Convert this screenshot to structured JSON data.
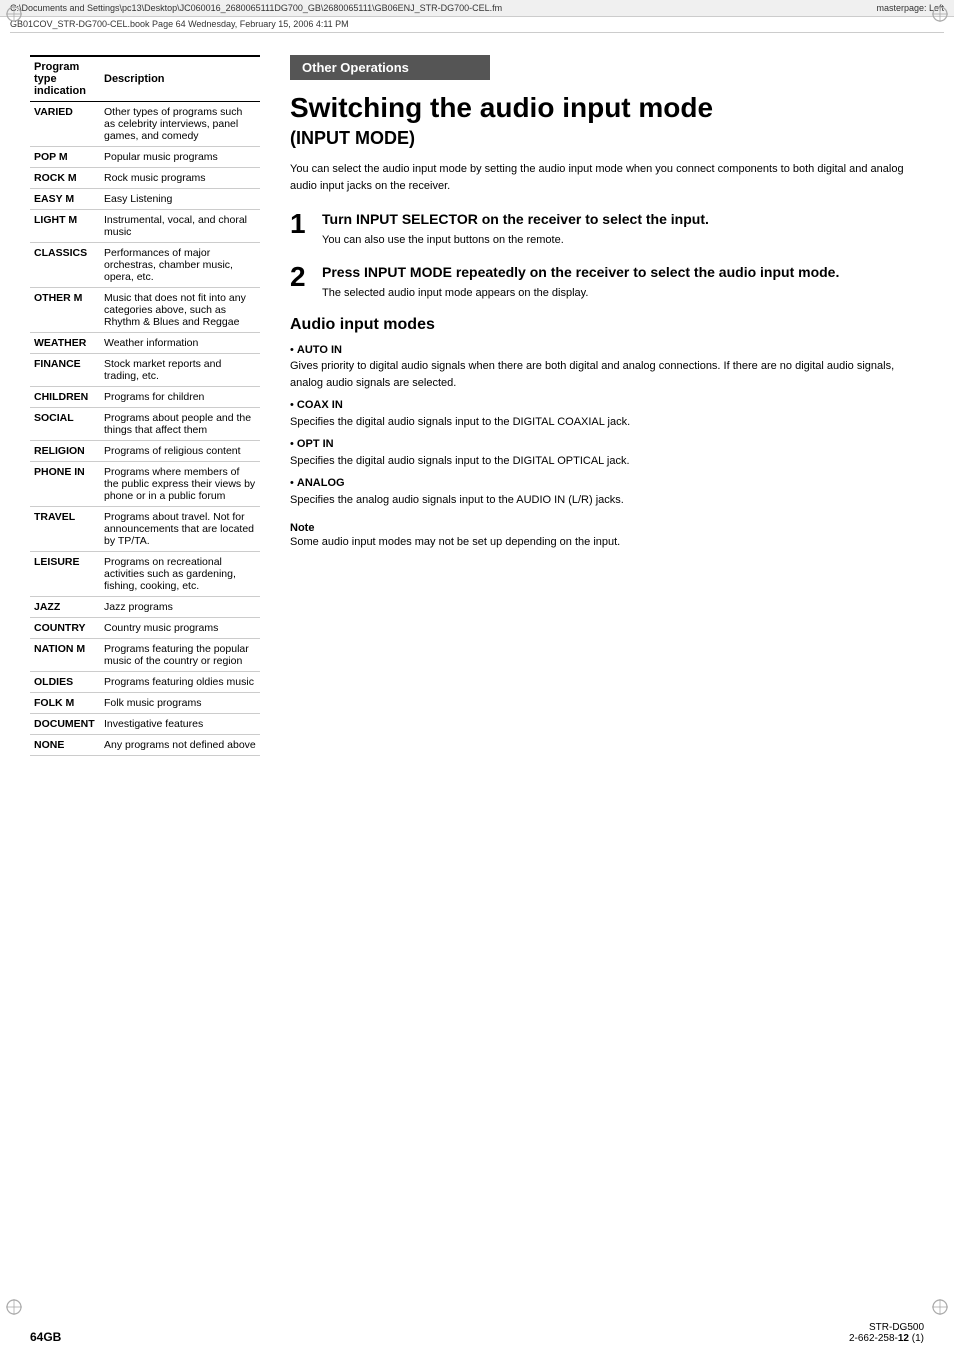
{
  "header": {
    "left_path": "C:\\Documents and Settings\\pc13\\Desktop\\JC060016_2680065111DG700_GB\\2680065111\\GB06ENJ_STR-DG700-CEL.fm",
    "right_label": "masterpage: Left",
    "book_info": "GB01COV_STR-DG700-CEL.book  Page 64  Wednesday, February 15, 2006  4:11 PM"
  },
  "table": {
    "col1_header": "Program type indication",
    "col2_header": "Description",
    "rows": [
      {
        "type": "VARIED",
        "desc": "Other types of programs such as celebrity interviews, panel games, and comedy"
      },
      {
        "type": "POP M",
        "desc": "Popular music programs"
      },
      {
        "type": "ROCK M",
        "desc": "Rock music programs"
      },
      {
        "type": "EASY M",
        "desc": "Easy Listening"
      },
      {
        "type": "LIGHT M",
        "desc": "Instrumental, vocal, and choral music"
      },
      {
        "type": "CLASSICS",
        "desc": "Performances of major orchestras, chamber music, opera, etc."
      },
      {
        "type": "OTHER M",
        "desc": "Music that does not fit into any categories above, such as Rhythm & Blues and Reggae"
      },
      {
        "type": "WEATHER",
        "desc": "Weather information"
      },
      {
        "type": "FINANCE",
        "desc": "Stock market reports and trading, etc."
      },
      {
        "type": "CHILDREN",
        "desc": "Programs for children"
      },
      {
        "type": "SOCIAL",
        "desc": "Programs about people and the things that affect them"
      },
      {
        "type": "RELIGION",
        "desc": "Programs of religious content"
      },
      {
        "type": "PHONE IN",
        "desc": "Programs where members of the public express their views by phone or in a public forum"
      },
      {
        "type": "TRAVEL",
        "desc": "Programs about travel. Not for announcements that are located by TP/TA."
      },
      {
        "type": "LEISURE",
        "desc": "Programs on recreational activities such as gardening, fishing, cooking, etc."
      },
      {
        "type": "JAZZ",
        "desc": "Jazz programs"
      },
      {
        "type": "COUNTRY",
        "desc": "Country music programs"
      },
      {
        "type": "NATION M",
        "desc": "Programs featuring the popular music of the country or region"
      },
      {
        "type": "OLDIES",
        "desc": "Programs featuring oldies music"
      },
      {
        "type": "FOLK M",
        "desc": "Folk music programs"
      },
      {
        "type": "DOCUMENT",
        "desc": "Investigative features"
      },
      {
        "type": "NONE",
        "desc": "Any programs not defined above"
      }
    ]
  },
  "right_section": {
    "banner": "Other Operations",
    "main_title": "Switching the audio input mode",
    "sub_title": "(INPUT MODE)",
    "intro": "You can select the audio input mode by setting the audio input mode when you connect components to both digital and analog audio input jacks on the receiver.",
    "step1": {
      "number": "1",
      "heading": "Turn INPUT SELECTOR on the receiver to select the input.",
      "desc": "You can also use the input buttons on the remote."
    },
    "step2": {
      "number": "2",
      "heading": "Press INPUT MODE repeatedly on the receiver to select the audio input mode.",
      "desc": "The selected audio input mode appears on the display."
    },
    "audio_modes_title": "Audio input modes",
    "modes": [
      {
        "name": "AUTO IN",
        "desc": "Gives priority to digital audio signals when there are both digital and analog connections. If there are no digital audio signals, analog audio signals are selected."
      },
      {
        "name": "COAX IN",
        "desc": "Specifies the digital audio signals input to the DIGITAL COAXIAL jack."
      },
      {
        "name": "OPT IN",
        "desc": "Specifies the digital audio signals input to the DIGITAL OPTICAL jack."
      },
      {
        "name": "ANALOG",
        "desc": "Specifies the analog audio signals input to the AUDIO IN (L/R) jacks."
      }
    ],
    "note_title": "Note",
    "note_text": "Some audio input modes may not be set up depending on the input."
  },
  "footer": {
    "page_number": "64GB",
    "model": "STR-DG500\n2-662-258-12 (1)"
  }
}
